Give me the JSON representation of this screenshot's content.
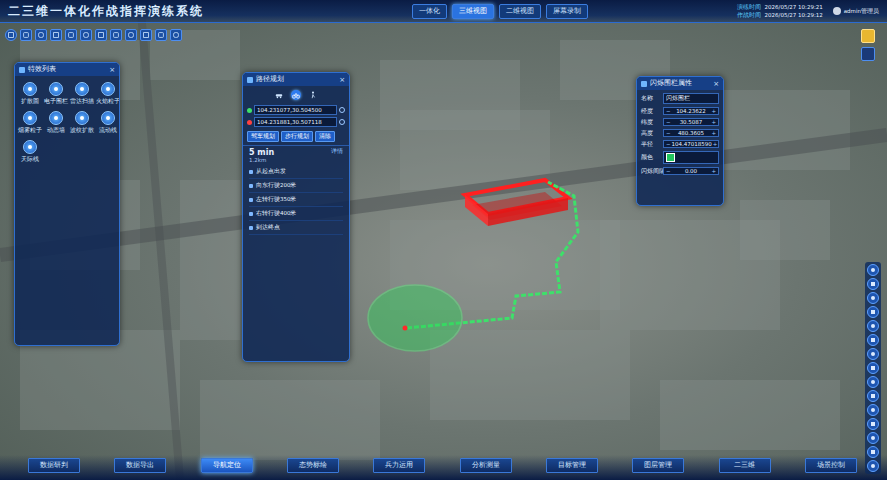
{
  "header": {
    "title": "二三维一体化作战指挥演练系统",
    "tabs": [
      {
        "label": "一体化",
        "selected": false
      },
      {
        "label": "三维视图",
        "selected": true
      },
      {
        "label": "二维视图",
        "selected": false
      },
      {
        "label": "屏幕录制",
        "selected": false
      }
    ],
    "times": [
      {
        "label": "演练时间",
        "value": "2026/05/27 10:29:21"
      },
      {
        "label": "作战时间",
        "value": "2026/05/27 10:29:12"
      }
    ],
    "user": "admin管理员"
  },
  "effects_panel": {
    "title": "特效列表",
    "close": "×",
    "items": [
      "扩散圆",
      "电子围栏",
      "雷达扫描",
      "火焰粒子",
      "烟雾粒子",
      "动态墙",
      "波纹扩散",
      "流动线",
      "天际线"
    ]
  },
  "route_panel": {
    "title": "路径规划",
    "close": "×",
    "modes": [
      {
        "selected": false
      },
      {
        "selected": true
      },
      {
        "selected": false
      }
    ],
    "start": "104.231077,30.504500",
    "end": "104.231881,30.507118",
    "buttons": [
      "驾车规划",
      "步行规划",
      "清除"
    ],
    "duration": "5 min",
    "distance": "1.2km",
    "detail": "详情",
    "steps": [
      "从起点出发",
      "向东行驶200米",
      "左转行驶350米",
      "右转行驶400米",
      "到达终点"
    ]
  },
  "fence_panel": {
    "title": "闪烁围栏属性",
    "close": "×",
    "spin_minus": "−",
    "spin_plus": "+",
    "fields": [
      {
        "label": "名称",
        "kind": "text",
        "value": "闪烁围栏"
      },
      {
        "label": "经度",
        "kind": "spin",
        "value": "104.23622"
      },
      {
        "label": "纬度",
        "kind": "spin",
        "value": "30.5087"
      },
      {
        "label": "高度",
        "kind": "spin",
        "value": "480.3605"
      },
      {
        "label": "半径",
        "kind": "spin",
        "value": "104.47018590"
      },
      {
        "label": "颜色",
        "kind": "color",
        "value": "#22c55e"
      },
      {
        "label": "闪烁间隔",
        "kind": "spin",
        "value": "0.00"
      }
    ]
  },
  "bottom_nav": [
    {
      "label": "数据研判",
      "selected": false
    },
    {
      "label": "数据导出",
      "selected": false
    },
    {
      "label": "导航定位",
      "selected": true
    },
    {
      "label": "态势标绘",
      "selected": false
    },
    {
      "label": "兵力运用",
      "selected": false
    },
    {
      "label": "分析测量",
      "selected": false
    },
    {
      "label": "目标管理",
      "selected": false
    },
    {
      "label": "图层管理",
      "selected": false
    },
    {
      "label": "二三维",
      "selected": false
    },
    {
      "label": "场景控制",
      "selected": false
    }
  ]
}
